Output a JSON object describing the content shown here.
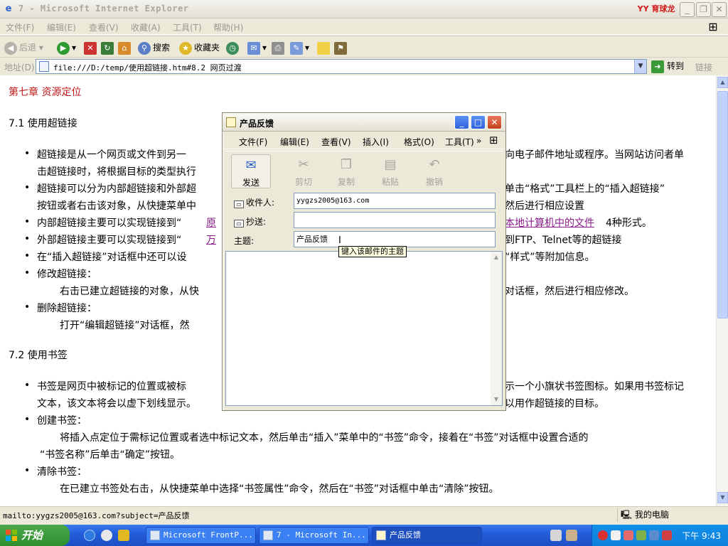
{
  "ie": {
    "title": "7 - Microsoft Internet Explorer",
    "brand": "YY 育球龙",
    "menu": [
      "文件(F)",
      "编辑(E)",
      "查看(V)",
      "收藏(A)",
      "工具(T)",
      "帮助(H)"
    ],
    "toolbar": {
      "back": "后退",
      "search": "搜索",
      "favorites": "收藏夹"
    },
    "address": {
      "label": "地址(D)",
      "url": "file:///D:/temp/使用超链接.htm#8.2  网页过渡",
      "go": "转到",
      "links": "链接"
    },
    "status": {
      "text": "mailto:yygzs2005@163.com?subject=产品反馈",
      "zone": "我的电脑"
    }
  },
  "page": {
    "chapter": "第七章  资源定位",
    "s71": "7.1 使用超链接",
    "b1_l1a": "超链接是从一个网页或文件到另一",
    "b1_l1b": "向电子邮件地址或程序。当网站访问者单",
    "b1_l2": "击超链接时，将根据目标的类型执行",
    "b2_l1a": "超链接可以分为内部超链接和外部超",
    "b2_l1b": "单击“格式”工具栏上的“插入超链接”",
    "b2_l2a": "按钮或者右击该对象，从快捷菜单中",
    "b2_l2b": "然后进行相应设置",
    "b3a": "内部超链接主要可以实现链接到“",
    "b3_link1": "原",
    "b3_link2": "本地计算机中的文件",
    "b3c": "4种形式。",
    "b4a": "外部超链接主要可以实现链接到“",
    "b4_link": "万",
    "b4c": "到FTP、Telnet等的超链接",
    "b5a": "在“插入超链接”对话框中还可以设",
    "b5b": "“样式”等附加信息。",
    "b6": "修改超链接：",
    "b6_desc_a": "右击已建立超链接的对象，从快",
    "b6_desc_b": "对话框，然后进行相应修改。",
    "b7": "删除超链接：",
    "b7_desc": "打开“编辑超链接”对话框，然",
    "s72": "7.2 使用书签",
    "c1_l1a": "书签是网页中被标记的位置或被标",
    "c1_l1b": "示一个小旗状书签图标。如果用书签标记",
    "c1_l2a": "文本，该文本将会以虚下划线显示。",
    "c1_l2b": "以用作超链接的目标。",
    "c2": "创建书签：",
    "c2_desc1": "将插入点定位于需标记位置或者选中标记文本，然后单击“插入”菜单中的“书签”命令，接着在“书签”对话框中设置合适的",
    "c2_desc2": "“书签名称”后单击“确定”按钮。",
    "c3": "清除书签：",
    "c3_desc": "在已建立书签处右击，从快捷菜单中选择“书签属性”命令，然后在“书签”对话框中单击“清除”按钮。"
  },
  "dialog": {
    "title": "产品反馈",
    "menu": [
      "文件(F)",
      "编辑(E)",
      "查看(V)",
      "插入(I)",
      "格式(O)",
      "工具(T)",
      "»"
    ],
    "buttons": [
      "发送",
      "剪切",
      "复制",
      "粘贴",
      "撤销"
    ],
    "to_label": "收件人:",
    "to_value": "yygzs2005@163.com",
    "cc_label": "抄送:",
    "cc_value": "",
    "subject_label": "主题:",
    "subject_value": "产品反馈",
    "tooltip": "键入该邮件的主题"
  },
  "taskbar": {
    "start": "开始",
    "tasks": [
      "Microsoft FrontP...",
      "7 - Microsoft In...",
      "产品反馈"
    ],
    "clock": "下午 9:43"
  }
}
